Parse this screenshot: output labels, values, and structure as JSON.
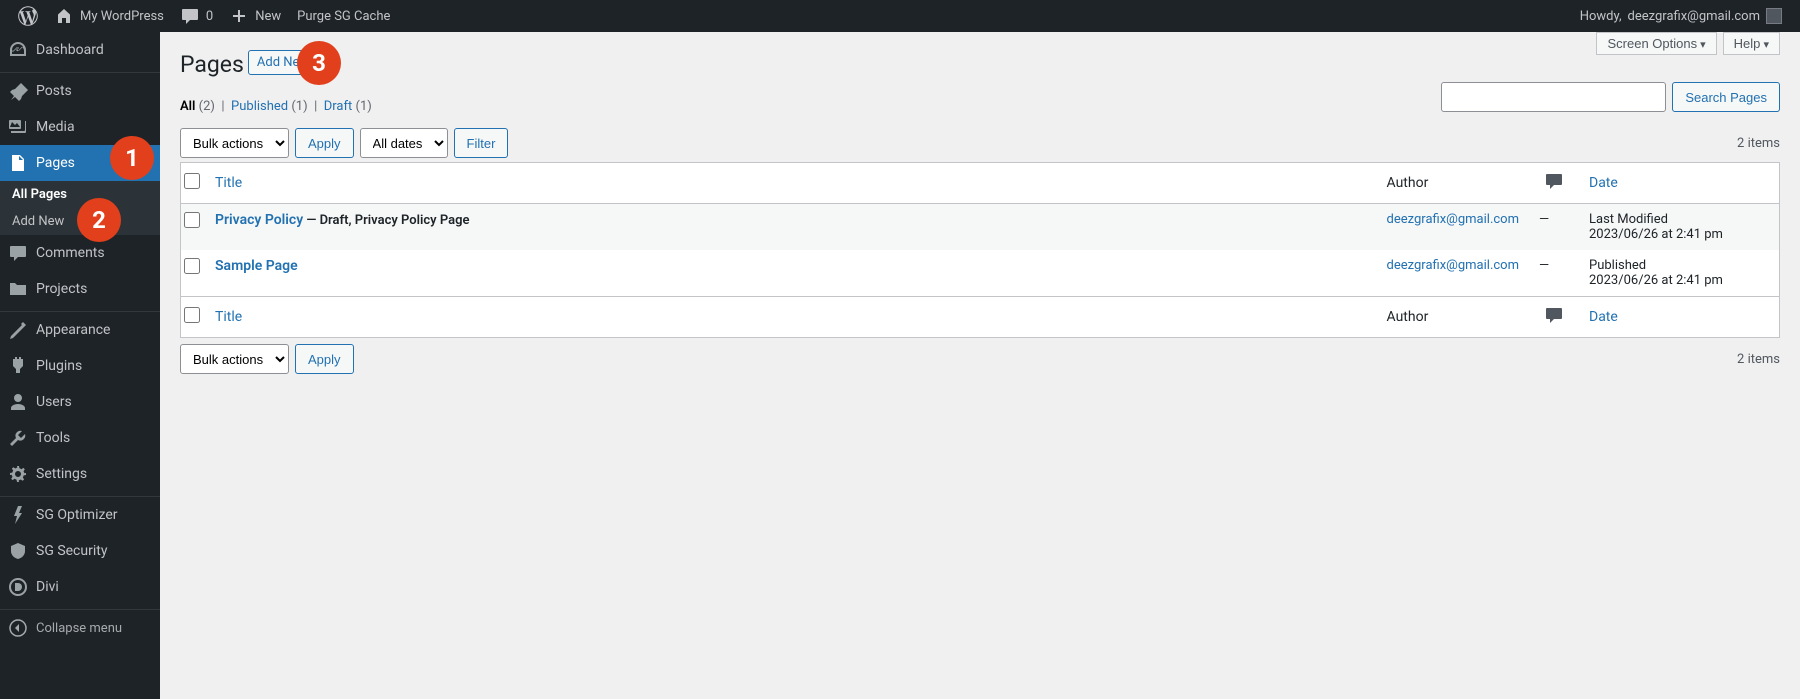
{
  "toolbar": {
    "site_name": "My WordPress",
    "comments_count": "0",
    "new_label": "New",
    "purge_label": "Purge SG Cache",
    "howdy_prefix": "Howdy, ",
    "howdy_user": "deezgrafix@gmail.com"
  },
  "sidebar": {
    "dashboard": "Dashboard",
    "posts": "Posts",
    "media": "Media",
    "pages": "Pages",
    "all_pages": "All Pages",
    "add_new": "Add New",
    "comments": "Comments",
    "projects": "Projects",
    "appearance": "Appearance",
    "plugins": "Plugins",
    "users": "Users",
    "tools": "Tools",
    "settings": "Settings",
    "sg_optimizer": "SG Optimizer",
    "sg_security": "SG Security",
    "divi": "Divi",
    "collapse": "Collapse menu"
  },
  "screen": {
    "screen_options": "Screen Options",
    "help": "Help"
  },
  "header": {
    "title": "Pages",
    "add_new": "Add New"
  },
  "callouts": {
    "one": "1",
    "two": "2",
    "three": "3"
  },
  "filters": {
    "all_label": "All ",
    "all_count": "(2)",
    "published_label": "Published ",
    "published_count": "(1)",
    "draft_label": "Draft ",
    "draft_count": "(1)"
  },
  "search": {
    "button": "Search Pages"
  },
  "tablenav": {
    "bulk_label": "Bulk actions",
    "apply": "Apply",
    "dates_label": "All dates",
    "filter": "Filter",
    "count": "2 items"
  },
  "table": {
    "col_title": "Title",
    "col_author": "Author",
    "col_date": "Date",
    "rows": [
      {
        "title": "Privacy Policy",
        "state": " — Draft, Privacy Policy Page",
        "author": "deezgrafix@gmail.com",
        "comments": "—",
        "date_status": "Last Modified",
        "date_value": "2023/06/26 at 2:41 pm"
      },
      {
        "title": "Sample Page",
        "state": "",
        "author": "deezgrafix@gmail.com",
        "comments": "—",
        "date_status": "Published",
        "date_value": "2023/06/26 at 2:41 pm"
      }
    ]
  }
}
